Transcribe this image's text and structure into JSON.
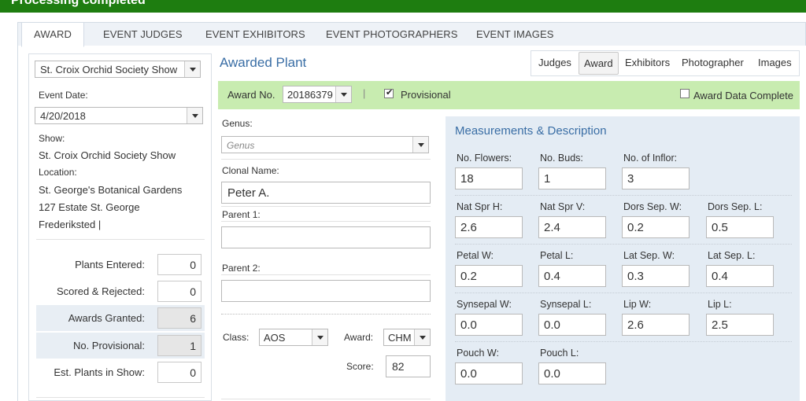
{
  "banner": {
    "text": "Processing completed"
  },
  "tabs": [
    {
      "label": "AWARD",
      "active": true
    },
    {
      "label": "EVENT JUDGES"
    },
    {
      "label": "EVENT EXHIBITORS"
    },
    {
      "label": "EVENT PHOTOGRAPHERS"
    },
    {
      "label": "EVENT IMAGES"
    }
  ],
  "left": {
    "show_select": "St. Croix Orchid Society Show",
    "event_date_label": "Event Date:",
    "event_date": "4/20/2018",
    "show_label": "Show:",
    "show_name": "St. Croix Orchid Society Show",
    "location_label": "Location:",
    "location_lines": [
      "St. George's Botanical Gardens",
      "127 Estate St. George",
      "Frederiksted |"
    ],
    "stats": [
      {
        "label": "Plants Entered:",
        "value": "0"
      },
      {
        "label": "Scored & Rejected:",
        "value": "0"
      },
      {
        "label": "Awards Granted:",
        "value": "6"
      },
      {
        "label": "No. Provisional:",
        "value": "1"
      },
      {
        "label": "Est. Plants in Show:",
        "value": "0"
      }
    ]
  },
  "main": {
    "title": "Awarded Plant",
    "right_tabs": [
      {
        "label": "Judges"
      },
      {
        "label": "Award",
        "active": true
      },
      {
        "label": "Exhibitors"
      },
      {
        "label": "Photographer"
      },
      {
        "label": "Images"
      }
    ],
    "award_no_label": "Award No.",
    "award_no": "20186379",
    "separator": "|",
    "provisional_label": "Provisional",
    "award_data_complete_label": "Award Data Complete",
    "genus_label": "Genus:",
    "genus_placeholder": "Genus",
    "clonal_label": "Clonal Name:",
    "clonal_value": "Peter A.",
    "parent1_label": "Parent 1:",
    "parent1_value": "",
    "parent2_label": "Parent 2:",
    "parent2_value": "",
    "class_label": "Class:",
    "class_value": "AOS",
    "award_label": "Award:",
    "award_value": "CHM",
    "score_label": "Score:",
    "score_value": "82"
  },
  "measurements": {
    "title": "Measurements & Description",
    "fields": {
      "no_flowers": {
        "label": "No. Flowers:",
        "value": "18"
      },
      "no_buds": {
        "label": "No. Buds:",
        "value": "1"
      },
      "no_inflor": {
        "label": "No. of Inflor:",
        "value": "3"
      },
      "nat_spr_h": {
        "label": "Nat Spr H:",
        "value": "2.6"
      },
      "nat_spr_v": {
        "label": "Nat Spr V:",
        "value": "2.4"
      },
      "dors_sep_w": {
        "label": "Dors Sep. W:",
        "value": "0.2"
      },
      "dors_sep_l": {
        "label": "Dors Sep. L:",
        "value": "0.5"
      },
      "petal_w": {
        "label": "Petal W:",
        "value": "0.2"
      },
      "petal_l": {
        "label": "Petal L:",
        "value": "0.4"
      },
      "lat_sep_w": {
        "label": "Lat Sep. W:",
        "value": "0.3"
      },
      "lat_sep_l": {
        "label": "Lat Sep. L:",
        "value": "0.4"
      },
      "synsepal_w": {
        "label": "Synsepal W:",
        "value": "0.0"
      },
      "synsepal_l": {
        "label": "Synsepal L:",
        "value": "0.0"
      },
      "lip_w": {
        "label": "Lip W:",
        "value": "2.6"
      },
      "lip_l": {
        "label": "Lip L:",
        "value": "2.5"
      },
      "pouch_w": {
        "label": "Pouch W:",
        "value": "0.0"
      },
      "pouch_l": {
        "label": "Pouch L:",
        "value": "0.0"
      }
    }
  },
  "colors": {
    "banner": "#1e7d10",
    "accent": "#3a6ea5",
    "greenbar": "#c8ecb0",
    "panel": "#e4ecf4"
  }
}
